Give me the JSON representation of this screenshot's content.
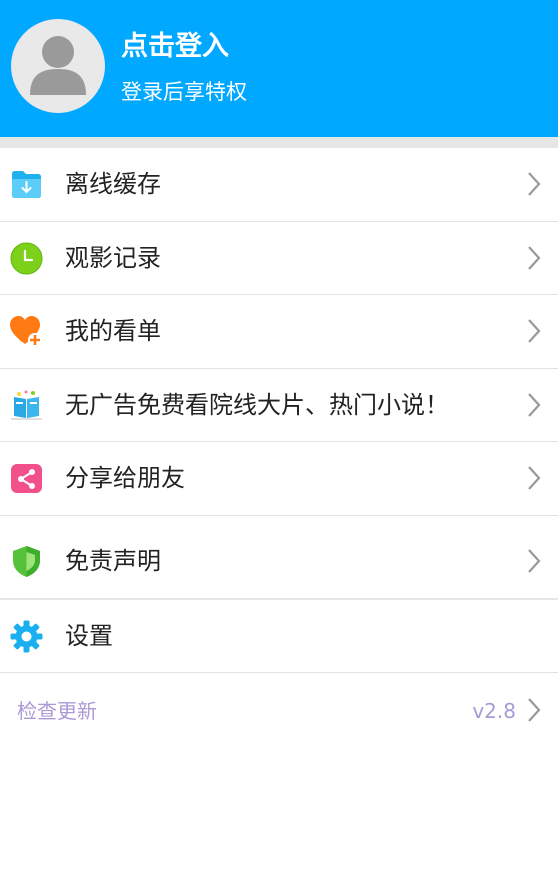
{
  "header": {
    "title": "点击登入",
    "subtitle": "登录后享特权"
  },
  "menu": [
    {
      "label": "离线缓存",
      "icon": "download-folder-icon"
    },
    {
      "label": "观影记录",
      "icon": "clock-icon"
    },
    {
      "label": "我的看单",
      "icon": "heart-plus-icon"
    },
    {
      "label": "无广告免费看院线大片、热门小说！",
      "icon": "book-icon"
    },
    {
      "label": "分享给朋友",
      "icon": "share-icon"
    },
    {
      "label": "免责声明",
      "icon": "shield-icon"
    },
    {
      "label": "设置",
      "icon": "gear-icon"
    }
  ],
  "footer": {
    "update_label": "检查更新",
    "version": "v2.8"
  }
}
